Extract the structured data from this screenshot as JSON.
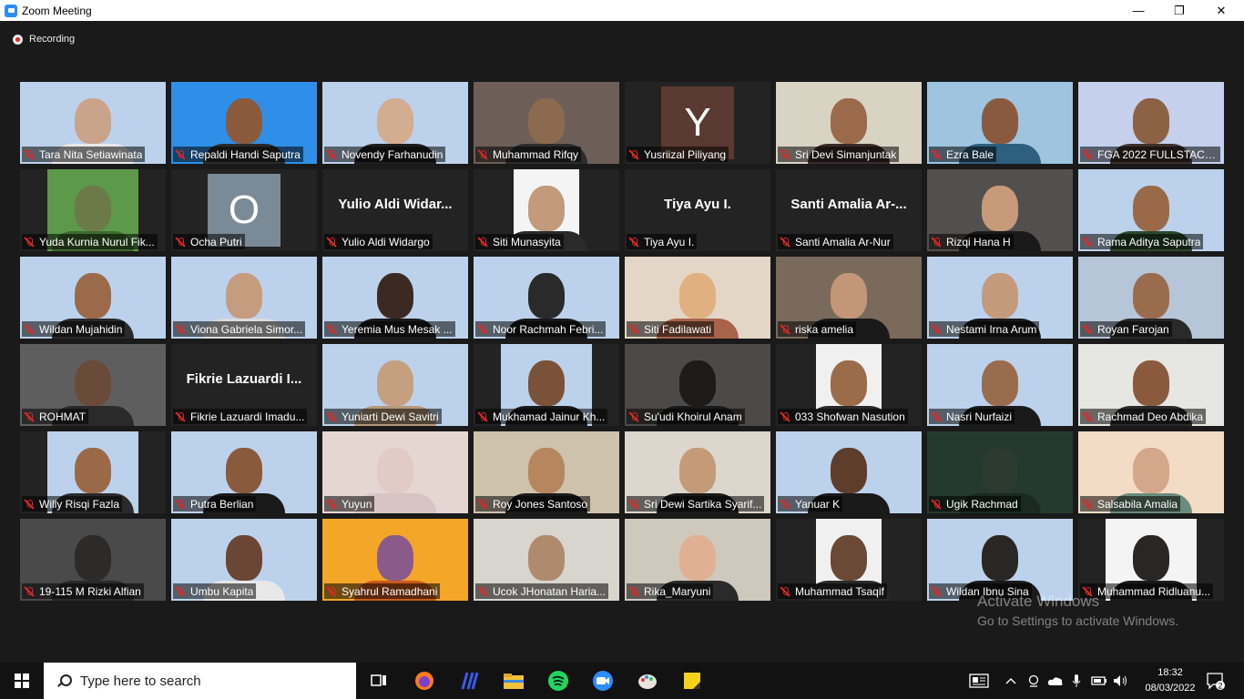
{
  "window": {
    "title": "Zoom Meeting",
    "minimize": "—",
    "maximize": "❐",
    "close": "✕"
  },
  "recording": {
    "label": "Recording"
  },
  "participants": [
    {
      "name": "Tara Nita Setiawinata",
      "kind": "video",
      "bg": "#bcd2ec",
      "skin": "#c9a48a",
      "shirt": "#eaeaea"
    },
    {
      "name": "Repaldi Handi Saputra",
      "kind": "video",
      "bg": "#2f8fe8",
      "skin": "#8a5a3c",
      "shirt": "#2a2a2a"
    },
    {
      "name": "Novendy Farhanudin",
      "kind": "video",
      "bg": "#bcd2ec",
      "skin": "#d3ad90",
      "shirt": "#1d1d1d"
    },
    {
      "name": "Muhammad Rifqy",
      "kind": "video",
      "bg": "#6d5f58",
      "skin": "#8c6a50",
      "shirt": "#2c2c2c"
    },
    {
      "name": "Yusriizal Piliyang",
      "kind": "avatar",
      "letter": "Y",
      "bg": "#5a3a30"
    },
    {
      "name": "Sri Devi Simanjuntak",
      "kind": "video",
      "bg": "#d9d3c4",
      "skin": "#9a6a4a",
      "shirt": "#3a2a2a"
    },
    {
      "name": "Ezra Bale",
      "kind": "video",
      "bg": "#9ec4e0",
      "skin": "#8a5a40",
      "shirt": "#2f5f7f"
    },
    {
      "name": "FGA 2022 FULLSTACK KE...",
      "kind": "video",
      "bg": "#c4d0ec",
      "skin": "#8c6244",
      "shirt": "#3d2f2a",
      "active": true
    },
    {
      "name": "Yuda Kurnia Nurul Fik...",
      "kind": "video",
      "bg": "#5c9a4a",
      "skin": "#6b7a48",
      "shirt": "#3e6a2e",
      "narrow": true
    },
    {
      "name": "Ocha Putri",
      "kind": "avatar",
      "letter": "O",
      "bg": "#7a8a96"
    },
    {
      "name": "Yulio Aldi Widargo",
      "kind": "text",
      "big": "Yulio Aldi Widar..."
    },
    {
      "name": "Siti Munasyita",
      "kind": "video",
      "bg": "#f4f4f4",
      "skin": "#c29a7c",
      "shirt": "#2a2a2a",
      "xnarrow": true
    },
    {
      "name": "Tiya Ayu I.",
      "kind": "text",
      "big": "Tiya Ayu I."
    },
    {
      "name": "Santi Amalia Ar-Nur",
      "kind": "text",
      "big": "Santi Amalia Ar-..."
    },
    {
      "name": "Rizqi Hana H",
      "kind": "video",
      "bg": "#52504e",
      "skin": "#c79a7a",
      "shirt": "#1a1a1a"
    },
    {
      "name": "Rama Aditya Saputra",
      "kind": "video",
      "bg": "#bcd2ec",
      "skin": "#9a6a48",
      "shirt": "#2a4a2a"
    },
    {
      "name": "Wildan Mujahidin",
      "kind": "video",
      "bg": "#bcd2ec",
      "skin": "#9a6a4a",
      "shirt": "#2a2a2a"
    },
    {
      "name": "Viona Gabriela Simor...",
      "kind": "video",
      "bg": "#bcd2ec",
      "skin": "#c69c7e",
      "shirt": "#dcdcdc"
    },
    {
      "name": "Yeremia Mus Mesak ...",
      "kind": "video",
      "bg": "#bcd2ec",
      "skin": "#3c2a22",
      "shirt": "#1c1c1c"
    },
    {
      "name": "Noor Rachmah Febri...",
      "kind": "video",
      "bg": "#bcd2ec",
      "skin": "#2a2a2a",
      "shirt": "#1a1a1a"
    },
    {
      "name": "Siti Fadilawati",
      "kind": "video",
      "bg": "#e3d6c6",
      "skin": "#e0b080",
      "shirt": "#a8644a"
    },
    {
      "name": "riska amelia",
      "kind": "video",
      "bg": "#7a6a5c",
      "skin": "#c49678",
      "shirt": "#1a1a1a"
    },
    {
      "name": "Nestami Irna Arum",
      "kind": "video",
      "bg": "#bcd2ec",
      "skin": "#c49a7c",
      "shirt": "#1a1a1a"
    },
    {
      "name": "Royan Farojan",
      "kind": "video",
      "bg": "#b6c6d8",
      "skin": "#9a6c4e",
      "shirt": "#2a2a2a"
    },
    {
      "name": "ROHMAT",
      "kind": "video",
      "bg": "#5e5e5e",
      "skin": "#6a4a38",
      "shirt": "#2a2a2a"
    },
    {
      "name": "Fikrie Lazuardi Imadu...",
      "kind": "text",
      "big": "Fikrie Lazuardi I..."
    },
    {
      "name": "Yuniarti Dewi Savitri",
      "kind": "video",
      "bg": "#bcd2ec",
      "skin": "#c4a07e",
      "shirt": "#b49a78"
    },
    {
      "name": "Mukhamad Jainur Kh...",
      "kind": "video",
      "bg": "#bcd2ec",
      "skin": "#7a5238",
      "shirt": "#1a1a1a",
      "narrow": true
    },
    {
      "name": "Su'udi Khoirul Anam",
      "kind": "video",
      "bg": "#4c4a48",
      "skin": "#1e1a18",
      "shirt": "#1a1a1a"
    },
    {
      "name": "033 Shofwan Nasution",
      "kind": "video",
      "bg": "#f0f0f0",
      "skin": "#9a6c4a",
      "shirt": "#2a2a2a",
      "xnarrow": true
    },
    {
      "name": "Nasri Nurfaizi",
      "kind": "video",
      "bg": "#bcd2ec",
      "skin": "#9a6c4e",
      "shirt": "#1a1a1a"
    },
    {
      "name": "Rachmad Deo Abdika",
      "kind": "video",
      "bg": "#e6e6e2",
      "skin": "#8a5a3c",
      "shirt": "#2a2a2a"
    },
    {
      "name": "Willy Risqi Fazla",
      "kind": "video",
      "bg": "#bcd2ec",
      "skin": "#9a6a48",
      "shirt": "#2a2a2a",
      "narrow": true
    },
    {
      "name": "Putra Berlian",
      "kind": "video",
      "bg": "#bcd2ec",
      "skin": "#8a5a3c",
      "shirt": "#1a1a1a"
    },
    {
      "name": "Yuyun",
      "kind": "video",
      "bg": "#e6d6d2",
      "skin": "#e2cac6",
      "shirt": "#d8c4c2"
    },
    {
      "name": "Roy Jones Santoso",
      "kind": "video",
      "bg": "#cfc2ac",
      "skin": "#b6865e",
      "shirt": "#1a1a1a"
    },
    {
      "name": "Sri Dewi Sartika Syarif...",
      "kind": "video",
      "bg": "#dcd6cc",
      "skin": "#c49a78",
      "shirt": "#1a1a1a"
    },
    {
      "name": "Yanuar K",
      "kind": "video",
      "bg": "#bcd2ec",
      "skin": "#5e3e2a",
      "shirt": "#1a1a1a"
    },
    {
      "name": "Ugik Rachmad",
      "kind": "video",
      "bg": "#243a2e",
      "skin": "#2c3a30",
      "shirt": "#1a2a22"
    },
    {
      "name": "Salsabila Amalia",
      "kind": "video",
      "bg": "#f2dcc6",
      "skin": "#d4a68a",
      "shirt": "#6a8c7c"
    },
    {
      "name": "19-115 M Rizki Alfian",
      "kind": "video",
      "bg": "#4a4a4a",
      "skin": "#2e2a28",
      "shirt": "#2a2a2a"
    },
    {
      "name": "Umbu Kapita",
      "kind": "video",
      "bg": "#bcd2ec",
      "skin": "#6c4634",
      "shirt": "#e8e8e8"
    },
    {
      "name": "Syahrul Ramadhani",
      "kind": "video",
      "bg": "#f4a628",
      "skin": "#8a5a8a",
      "shirt": "#c85a1a"
    },
    {
      "name": "Ucok JHonatan Haria...",
      "kind": "video",
      "bg": "#d8d4ce",
      "skin": "#b08a6c",
      "shirt": "#d8d4ce"
    },
    {
      "name": "Rika_Maryuni",
      "kind": "video",
      "bg": "#cfc8bc",
      "skin": "#e0b094",
      "shirt": "#2a2a2a"
    },
    {
      "name": "Muhammad Tsaqif",
      "kind": "video",
      "bg": "#f0f0f0",
      "skin": "#6a4a36",
      "shirt": "#2a2a2a",
      "xnarrow": true
    },
    {
      "name": "Wildan Ibnu Sina",
      "kind": "video",
      "bg": "#bcd2ec",
      "skin": "#2a2624",
      "shirt": "#1a1a1a"
    },
    {
      "name": "Muhammad Ridluanu...",
      "kind": "video",
      "bg": "#f4f4f4",
      "skin": "#2a2626",
      "shirt": "#1a1a1a",
      "narrow": true
    }
  ],
  "watermark": {
    "line1": "Activate Windows",
    "line2": "Go to Settings to activate Windows."
  },
  "taskbar": {
    "search_placeholder": "Type here to search",
    "apps": [
      "task-view",
      "firefox",
      "terminal",
      "file-explorer",
      "spotify",
      "zoom",
      "paint",
      "sticky-notes"
    ],
    "time": "18:32",
    "date": "08/03/2022",
    "notification_count": "2"
  }
}
